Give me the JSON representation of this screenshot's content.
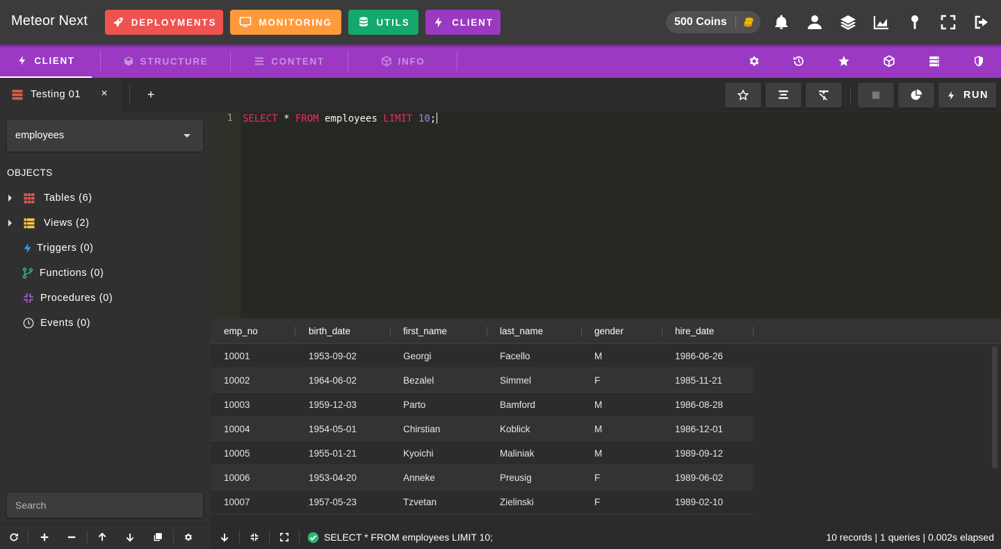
{
  "app": {
    "title": "Meteor Next"
  },
  "nav": {
    "deployments": "DEPLOYMENTS",
    "monitoring": "MONITORING",
    "utils": "UTILS",
    "client": "CLIENT"
  },
  "coins": {
    "label": "500 Coins"
  },
  "top_icons": [
    "bell-icon",
    "user-icon",
    "layers-icon",
    "chart-area-icon",
    "pin-icon",
    "fullscreen-icon",
    "logout-icon"
  ],
  "tabs": {
    "client": "CLIENT",
    "structure": "STRUCTURE",
    "content": "CONTENT",
    "info": "INFO"
  },
  "tab_right_icons": [
    "gear-icon",
    "history-icon",
    "star-icon",
    "cube-icon",
    "server-icon",
    "shield-icon"
  ],
  "connection": {
    "tab_label": "Testing 01",
    "close": "×",
    "add": "+"
  },
  "toolbar": {
    "run_label": "RUN"
  },
  "sidebar": {
    "database": "employees",
    "objects_title": "OBJECTS",
    "items": [
      {
        "label": "Tables (6)",
        "icon": "table-icon",
        "color": "#e05a4e"
      },
      {
        "label": "Views (2)",
        "icon": "view-icon",
        "color": "#f2c94c"
      },
      {
        "label": "Triggers (0)",
        "icon": "bolt-icon",
        "color": "#2f9cf0"
      },
      {
        "label": "Functions (0)",
        "icon": "branch-icon",
        "color": "#2bb673"
      },
      {
        "label": "Procedures (0)",
        "icon": "compress-icon",
        "color": "#a855d8"
      },
      {
        "label": "Events (0)",
        "icon": "clock-icon",
        "color": "#d0d0d0"
      }
    ],
    "search_placeholder": "Search"
  },
  "editor": {
    "line_number": "1",
    "tokens": {
      "select": "SELECT",
      "star": " * ",
      "from": "FROM",
      "table": " employees ",
      "limit": "LIMIT",
      "space": " ",
      "number": "10",
      "semicolon": ";"
    }
  },
  "grid": {
    "columns": [
      "emp_no",
      "birth_date",
      "first_name",
      "last_name",
      "gender",
      "hire_date"
    ],
    "rows": [
      [
        "10001",
        "1953-09-02",
        "Georgi",
        "Facello",
        "M",
        "1986-06-26"
      ],
      [
        "10002",
        "1964-06-02",
        "Bezalel",
        "Simmel",
        "F",
        "1985-11-21"
      ],
      [
        "10003",
        "1959-12-03",
        "Parto",
        "Bamford",
        "M",
        "1986-08-28"
      ],
      [
        "10004",
        "1954-05-01",
        "Chirstian",
        "Koblick",
        "M",
        "1986-12-01"
      ],
      [
        "10005",
        "1955-01-21",
        "Kyoichi",
        "Maliniak",
        "M",
        "1989-09-12"
      ],
      [
        "10006",
        "1953-04-20",
        "Anneke",
        "Preusig",
        "F",
        "1989-06-02"
      ],
      [
        "10007",
        "1957-05-23",
        "Tzvetan",
        "Zielinski",
        "F",
        "1989-02-10"
      ]
    ]
  },
  "status": {
    "query": "SELECT * FROM employees LIMIT 10;",
    "stats": "10 records | 1 queries | 0.002s elapsed"
  },
  "colors": {
    "deployments": "#ef5350",
    "monitoring": "#ff9a3c",
    "utils": "#15a86b",
    "client": "#9b3ac0",
    "tab_bar": "#9c39c3",
    "success": "#2bb673"
  }
}
